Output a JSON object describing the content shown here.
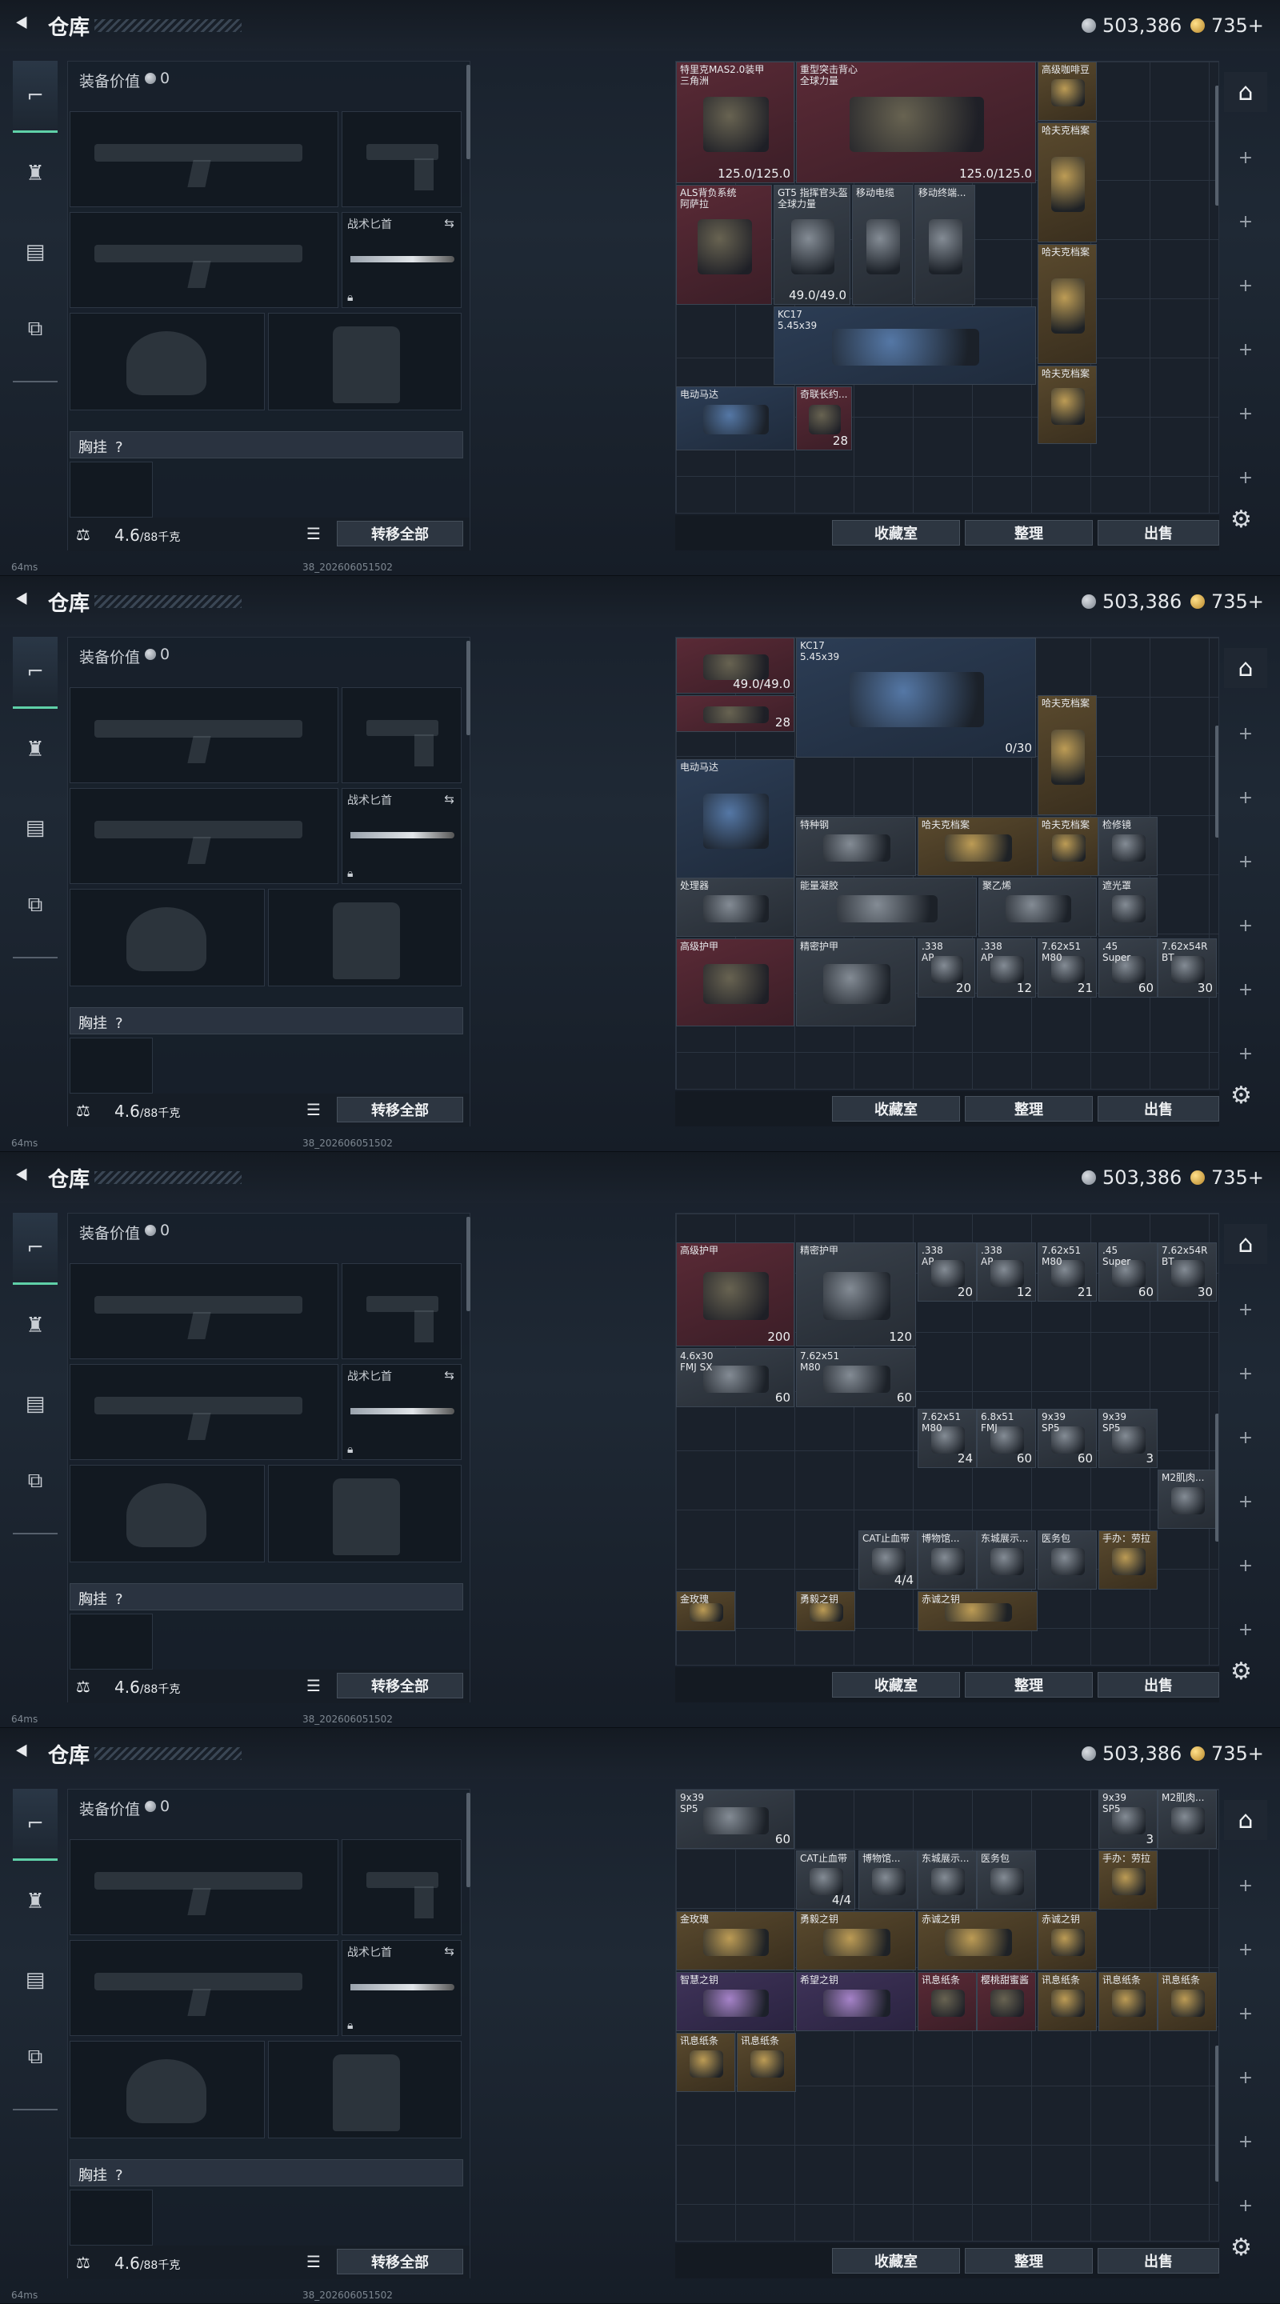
{
  "header": {
    "title": "仓库",
    "silver": "503,386",
    "gold": "735+"
  },
  "equipment": {
    "value_label": "装备价值",
    "value": "0",
    "knife_label": "战术匕首",
    "chest_label": "胸挂",
    "chest_hint": "?",
    "weight": "4.6",
    "weight_max": "/88千克",
    "transfer_all": "转移全部"
  },
  "stash_buttons": {
    "collection": "收藏室",
    "sort": "整理",
    "sell": "出售"
  },
  "status": {
    "ping": "64ms",
    "build": "38_202606051502"
  },
  "frames": [
    {
      "items": [
        {
          "name": "特里克MAS2.0装甲\n三角洲",
          "qty": "125.0/125.0",
          "color": "red"
        },
        {
          "name": "重型突击背心\n全球力量",
          "qty": "125.0/125.0",
          "color": "red"
        },
        {
          "name": "高级咖啡豆",
          "qty": "",
          "color": "gold"
        },
        {
          "name": "哈夫克档案",
          "qty": "",
          "color": "gold"
        },
        {
          "name": "ALS背负系统\n阿萨拉",
          "qty": "",
          "color": "red"
        },
        {
          "name": "GT5 指挥官头盔\n全球力量",
          "qty": "49.0/49.0",
          "color": "gray"
        },
        {
          "name": "移动电缆",
          "qty": "",
          "color": "gray"
        },
        {
          "name": "移动终端...",
          "qty": "",
          "color": "gray"
        },
        {
          "name": "哈夫克档案",
          "qty": "",
          "color": "gold"
        },
        {
          "name": "KC17\n5.45x39",
          "qty": "",
          "color": "blue"
        },
        {
          "name": "哈夫克档案",
          "qty": "",
          "color": "gold"
        },
        {
          "name": "电动马达",
          "qty": "",
          "color": "blue"
        },
        {
          "name": "奇联长约...",
          "qty": "28",
          "color": "red"
        }
      ]
    },
    {
      "items": [
        {
          "name": "",
          "qty": "49.0/49.0",
          "color": "red"
        },
        {
          "name": "",
          "qty": "28",
          "color": "red"
        },
        {
          "name": "KC17\n5.45x39",
          "qty": "0/30",
          "color": "blue"
        },
        {
          "name": "哈夫克档案",
          "qty": "",
          "color": "gold"
        },
        {
          "name": "电动马达",
          "qty": "",
          "color": "blue"
        },
        {
          "name": "特种钢",
          "qty": "",
          "color": "gray"
        },
        {
          "name": "哈夫克档案",
          "qty": "",
          "color": "gold"
        },
        {
          "name": "哈夫克档案",
          "qty": "",
          "color": "gold"
        },
        {
          "name": "检修镜",
          "qty": "",
          "color": "gray"
        },
        {
          "name": "处理器",
          "qty": "",
          "color": "gray"
        },
        {
          "name": "能量凝胶",
          "qty": "",
          "color": "gray"
        },
        {
          "name": "聚乙烯",
          "qty": "",
          "color": "gray"
        },
        {
          "name": "遮光罩",
          "qty": "",
          "color": "gray"
        },
        {
          "name": "高级护甲",
          "qty": "",
          "color": "red"
        },
        {
          "name": "精密护甲",
          "qty": "",
          "color": "gray"
        },
        {
          "name": ".338\nAP",
          "qty": "20",
          "color": "gray"
        },
        {
          "name": ".338\nAP",
          "qty": "12",
          "color": "gray"
        },
        {
          "name": "7.62x51\nM80",
          "qty": "21",
          "color": "gray"
        },
        {
          "name": ".45\nSuper",
          "qty": "60",
          "color": "gray"
        },
        {
          "name": "7.62x54R\nBT",
          "qty": "30",
          "color": "gray"
        }
      ]
    },
    {
      "items": [
        {
          "name": "高级护甲",
          "qty": "200",
          "color": "red"
        },
        {
          "name": "精密护甲",
          "qty": "120",
          "color": "gray"
        },
        {
          "name": ".338\nAP",
          "qty": "20",
          "color": "gray"
        },
        {
          "name": ".338\nAP",
          "qty": "12",
          "color": "gray"
        },
        {
          "name": "7.62x51\nM80",
          "qty": "21",
          "color": "gray"
        },
        {
          "name": ".45\nSuper",
          "qty": "60",
          "color": "gray"
        },
        {
          "name": "7.62x54R\nBT",
          "qty": "30",
          "color": "gray"
        },
        {
          "name": "4.6x30\nFMJ SX",
          "qty": "60",
          "color": "gray"
        },
        {
          "name": "7.62x51\nM80",
          "qty": "60",
          "color": "gray"
        },
        {
          "name": "7.62x51\nM80",
          "qty": "24",
          "color": "gray"
        },
        {
          "name": "6.8x51\nFMJ",
          "qty": "60",
          "color": "gray"
        },
        {
          "name": "9x39\nSP5",
          "qty": "60",
          "color": "gray"
        },
        {
          "name": "9x39\nSP5",
          "qty": "3",
          "color": "gray"
        },
        {
          "name": "M2肌肉...",
          "qty": "",
          "color": "gray"
        },
        {
          "name": "CAT止血带",
          "qty": "4/4",
          "color": "gray"
        },
        {
          "name": "博物馆...",
          "qty": "",
          "color": "gray"
        },
        {
          "name": "东城展示...",
          "qty": "",
          "color": "gray"
        },
        {
          "name": "医务包",
          "qty": "",
          "color": "gray"
        },
        {
          "name": "手办：劳拉",
          "qty": "",
          "color": "gold"
        },
        {
          "name": "金玫瑰",
          "qty": "",
          "color": "gold"
        },
        {
          "name": "勇毅之钥",
          "qty": "",
          "color": "gold"
        },
        {
          "name": "赤诚之钥",
          "qty": "",
          "color": "gold"
        }
      ]
    },
    {
      "items": [
        {
          "name": "9x39\nSP5",
          "qty": "60",
          "color": "gray"
        },
        {
          "name": "9x39\nSP5",
          "qty": "3",
          "color": "gray"
        },
        {
          "name": "M2肌肉...",
          "qty": "",
          "color": "gray"
        },
        {
          "name": "CAT止血带",
          "qty": "4/4",
          "color": "gray"
        },
        {
          "name": "博物馆...",
          "qty": "",
          "color": "gray"
        },
        {
          "name": "东城展示...",
          "qty": "",
          "color": "gray"
        },
        {
          "name": "医务包",
          "qty": "",
          "color": "gray"
        },
        {
          "name": "手办：劳拉",
          "qty": "",
          "color": "gold"
        },
        {
          "name": "金玫瑰",
          "qty": "",
          "color": "gold"
        },
        {
          "name": "勇毅之钥",
          "qty": "",
          "color": "gold"
        },
        {
          "name": "赤诚之钥",
          "qty": "",
          "color": "gold"
        },
        {
          "name": "赤诚之钥",
          "qty": "",
          "color": "gold"
        },
        {
          "name": "智慧之钥",
          "qty": "",
          "color": "purple"
        },
        {
          "name": "希望之钥",
          "qty": "",
          "color": "purple"
        },
        {
          "name": "讯息纸条",
          "qty": "",
          "color": "red"
        },
        {
          "name": "樱桃甜蜜酱",
          "qty": "",
          "color": "red"
        },
        {
          "name": "讯息纸条",
          "qty": "",
          "color": "gold"
        },
        {
          "name": "讯息纸条",
          "qty": "",
          "color": "gold"
        },
        {
          "name": "讯息纸条",
          "qty": "",
          "color": "gold"
        },
        {
          "name": "讯息纸条",
          "qty": "",
          "color": "gold"
        },
        {
          "name": "讯息纸条",
          "qty": "",
          "color": "gold"
        }
      ]
    }
  ],
  "icons": {
    "back": "chevron-left-icon",
    "weapon_tab": "pistol-icon",
    "armor_tab": "vest-icon",
    "backpack_tab": "clipboard-icon",
    "case_tab": "briefcase-icon",
    "lock": "lock-icon",
    "list": "list-icon",
    "gear": "gear-icon",
    "swap": "swap-icon"
  }
}
